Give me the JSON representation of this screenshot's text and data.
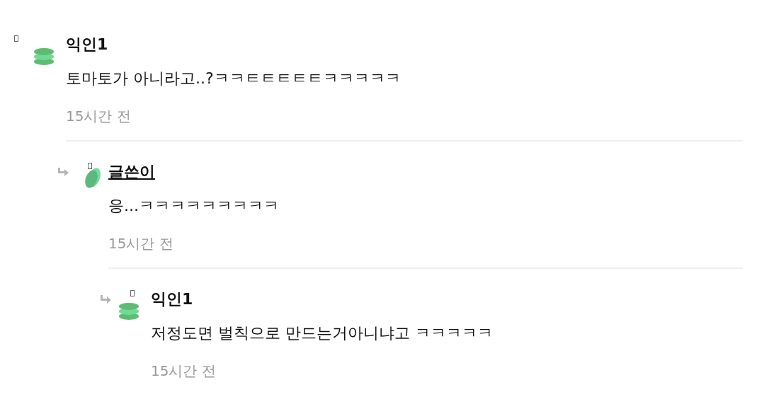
{
  "comments": [
    {
      "author": "익인1",
      "is_author": false,
      "text": "토마토가 아니라고..?ㅋㅋㅌㅌㅌㅌㅌㅋㅋㅋㅋㅋ",
      "time": "15시간 전",
      "children": [
        {
          "author": "글쓴이",
          "is_author": true,
          "text": "응...ㅋㅋㅋㅋㅋㅋㅋㅋㅋ",
          "time": "15시간 전",
          "children": [
            {
              "author": "익인1",
              "is_author": false,
              "text": "저정도면 벌칙으로 만드는거아니냐고 ㅋㅋㅋㅋㅋ",
              "time": "15시간 전"
            }
          ]
        }
      ]
    }
  ]
}
